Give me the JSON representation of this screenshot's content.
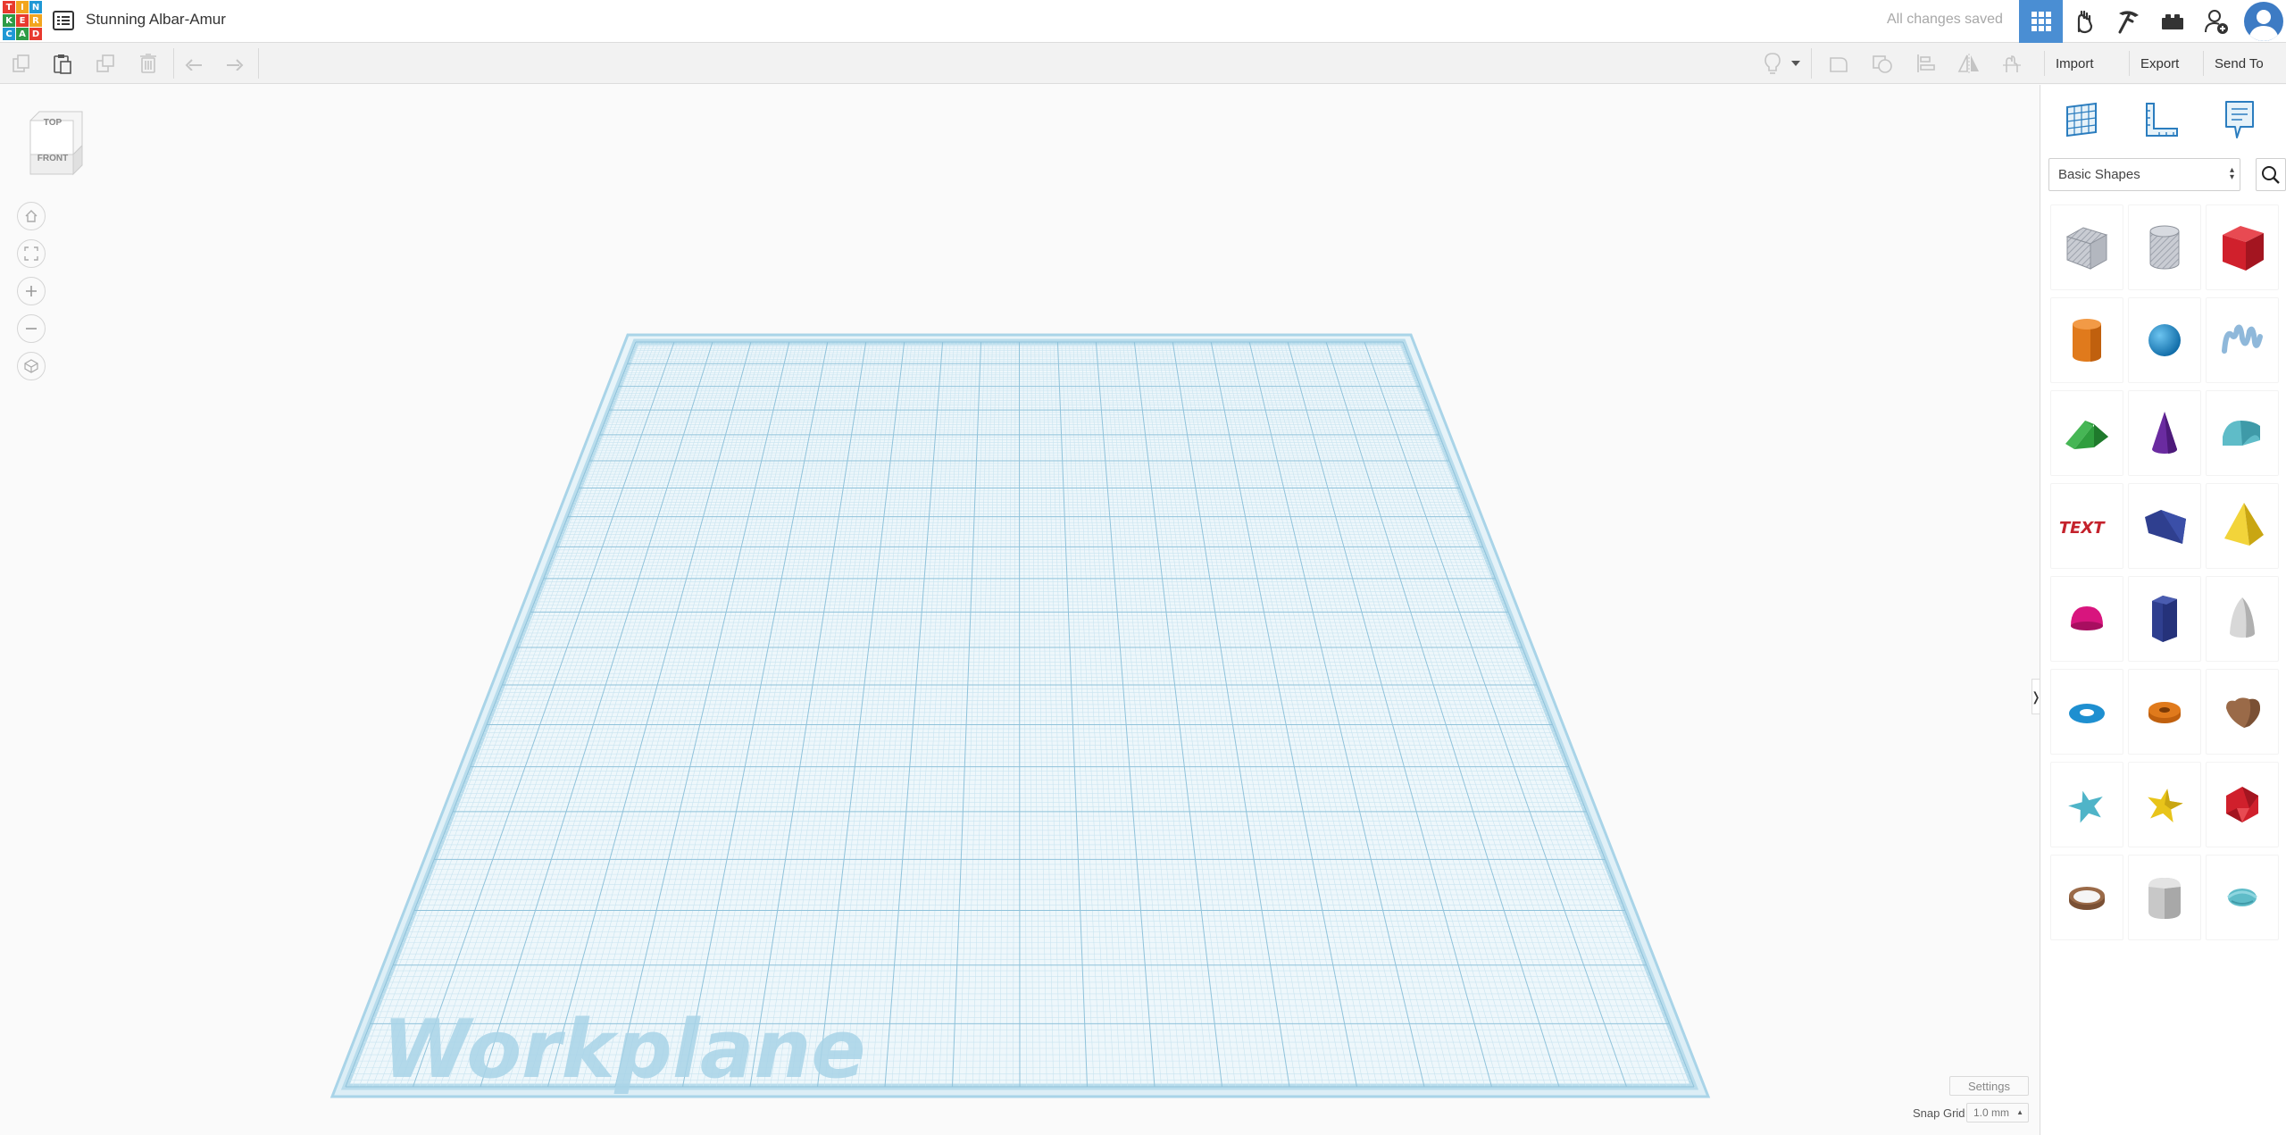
{
  "app": {
    "logo_letters": [
      "T",
      "I",
      "N",
      "K",
      "E",
      "R",
      "C",
      "A",
      "D"
    ],
    "design_title": "Stunning Albar-Amur",
    "save_status": "All changes saved"
  },
  "topnav": [
    {
      "name": "3d-design-icon",
      "active": true
    },
    {
      "name": "circuits-icon",
      "active": false
    },
    {
      "name": "codeblocks-icon",
      "active": false
    },
    {
      "name": "bricks-icon",
      "active": false
    },
    {
      "name": "invite-user-icon",
      "active": false
    }
  ],
  "toolbar": {
    "actions": [
      {
        "name": "copy-icon",
        "enabled": false
      },
      {
        "name": "paste-icon",
        "enabled": true
      },
      {
        "name": "duplicate-icon",
        "enabled": false
      },
      {
        "name": "delete-icon",
        "enabled": false
      },
      {
        "name": "undo-icon",
        "enabled": false
      },
      {
        "name": "redo-icon",
        "enabled": false
      }
    ],
    "import_label": "Import",
    "export_label": "Export",
    "send_to_label": "Send To"
  },
  "viewcube": {
    "top_label": "TOP",
    "front_label": "FRONT"
  },
  "workplane": {
    "label": "Workplane"
  },
  "bottom_controls": {
    "settings_label": "Settings",
    "snap_grid_label": "Snap Grid",
    "snap_grid_value": "1.0 mm"
  },
  "panel": {
    "tabs": [
      "workplane-tool-icon",
      "ruler-tool-icon",
      "notes-tool-icon"
    ],
    "shape_category": "Basic Shapes",
    "collapse_glyph": "❭",
    "shapes": [
      {
        "name": "box-hole",
        "color": "#b8bcc4"
      },
      {
        "name": "cylinder-hole",
        "color": "#b8bcc4"
      },
      {
        "name": "box",
        "color": "#d0202c"
      },
      {
        "name": "cylinder",
        "color": "#e07a1c"
      },
      {
        "name": "sphere",
        "color": "#1e8fd0"
      },
      {
        "name": "scribble",
        "color": "#8fb8da"
      },
      {
        "name": "roof",
        "color": "#2f9e3e"
      },
      {
        "name": "cone",
        "color": "#6a2ba0"
      },
      {
        "name": "round-roof",
        "color": "#5fbcc8"
      },
      {
        "name": "text",
        "color": "#c4222c"
      },
      {
        "name": "wedge",
        "color": "#2f3f8f"
      },
      {
        "name": "pyramid",
        "color": "#e8c41a"
      },
      {
        "name": "half-sphere",
        "color": "#d8157e"
      },
      {
        "name": "polygon",
        "color": "#2f3f8f"
      },
      {
        "name": "paraboloid",
        "color": "#d4d4d4"
      },
      {
        "name": "torus",
        "color": "#1e8fd0"
      },
      {
        "name": "tube",
        "color": "#e07a1c"
      },
      {
        "name": "heart",
        "color": "#9a6a48"
      },
      {
        "name": "star",
        "color": "#4fb4c8"
      },
      {
        "name": "star-gold",
        "color": "#e8c41a"
      },
      {
        "name": "icosahedron",
        "color": "#d0202c"
      },
      {
        "name": "ring",
        "color": "#9a6a48"
      },
      {
        "name": "round-box",
        "color": "#c8c8c8"
      },
      {
        "name": "microphone",
        "color": "#5fbcc8"
      }
    ]
  }
}
